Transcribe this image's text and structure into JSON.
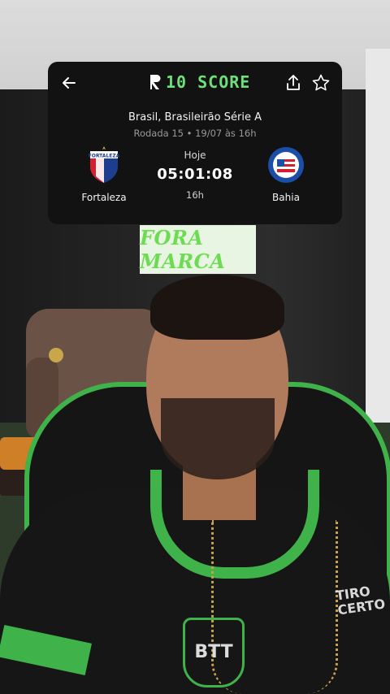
{
  "app": {
    "logo_text": "10 SCORE",
    "accent_color": "#6ee07a"
  },
  "card": {
    "icons": {
      "back": "arrow-left-icon",
      "share": "share-icon",
      "favorite": "star-outline-icon"
    },
    "league": "Brasil, Brasileirão Série A",
    "round_info": "Rodada 15 • 19/07 às 16h",
    "home_team": {
      "name": "Fortaleza",
      "crest_text": "FORTALEZA"
    },
    "away_team": {
      "name": "Bahia",
      "crest_text": "ESPORTE CLUBE BAHIA"
    },
    "day_label": "Hoje",
    "countdown": "05:01:08",
    "kickoff": "16h"
  },
  "overlay": {
    "caption": "FORA MARCA",
    "caption_color": "#6edc52"
  },
  "video": {
    "crest_text": "BTT",
    "sponsor_text": "TIRO CERTO"
  }
}
